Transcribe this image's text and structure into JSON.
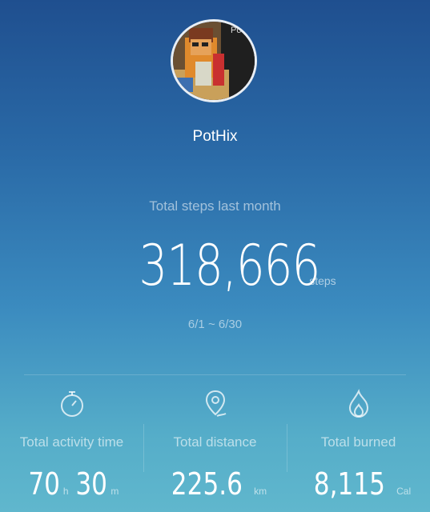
{
  "profile": {
    "username": "PotHix",
    "avatar_text": "Po"
  },
  "summary": {
    "caption": "Total steps last month",
    "steps_value": "318,666",
    "steps_unit": "steps",
    "date_range": "6/1 ~ 6/30"
  },
  "stats": [
    {
      "icon": "stopwatch-icon",
      "label": "Total activity time",
      "hours": "70",
      "hours_unit": "h",
      "minutes": "30",
      "minutes_unit": "m"
    },
    {
      "icon": "location-pin-icon",
      "label": "Total distance",
      "value": "225.6",
      "unit": "km"
    },
    {
      "icon": "flame-icon",
      "label": "Total burned",
      "value": "8,115",
      "unit": "Cal"
    }
  ]
}
